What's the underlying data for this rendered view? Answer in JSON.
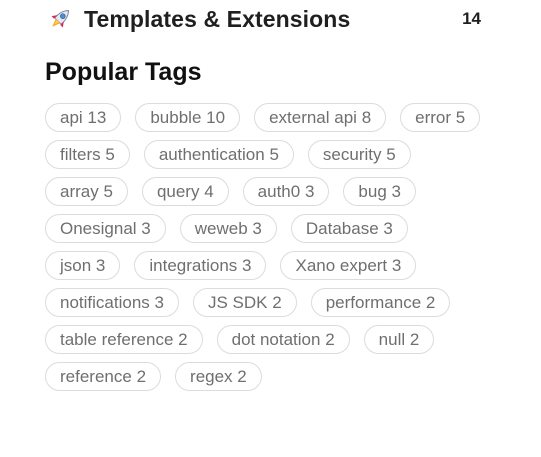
{
  "category": {
    "icon": "rocket-icon",
    "name": "Templates & Extensions",
    "count": "14"
  },
  "popular_tags": {
    "title": "Popular Tags",
    "tags": [
      {
        "name": "api",
        "count": "13"
      },
      {
        "name": "bubble",
        "count": "10"
      },
      {
        "name": "external api",
        "count": "8"
      },
      {
        "name": "error",
        "count": "5"
      },
      {
        "name": "filters",
        "count": "5"
      },
      {
        "name": "authentication",
        "count": "5"
      },
      {
        "name": "security",
        "count": "5"
      },
      {
        "name": "array",
        "count": "5"
      },
      {
        "name": "query",
        "count": "4"
      },
      {
        "name": "auth0",
        "count": "3"
      },
      {
        "name": "bug",
        "count": "3"
      },
      {
        "name": "Onesignal",
        "count": "3"
      },
      {
        "name": "weweb",
        "count": "3"
      },
      {
        "name": "Database",
        "count": "3"
      },
      {
        "name": "json",
        "count": "3"
      },
      {
        "name": "integrations",
        "count": "3"
      },
      {
        "name": "Xano expert",
        "count": "3"
      },
      {
        "name": "notifications",
        "count": "3"
      },
      {
        "name": "JS SDK",
        "count": "2"
      },
      {
        "name": "performance",
        "count": "2"
      },
      {
        "name": "table reference",
        "count": "2"
      },
      {
        "name": "dot notation",
        "count": "2"
      },
      {
        "name": "null",
        "count": "2"
      },
      {
        "name": "reference",
        "count": "2"
      },
      {
        "name": "regex",
        "count": "2"
      }
    ]
  }
}
